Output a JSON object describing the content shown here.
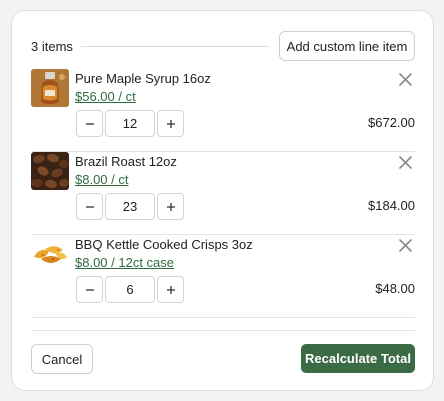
{
  "header": {
    "item_count": "3 items",
    "add_custom_label": "Add custom line item"
  },
  "items": [
    {
      "name": "Pure Maple Syrup 16oz",
      "price": "$56.00 / ct",
      "quantity": "12",
      "total": "$672.00",
      "thumbnail_icon": "maple-syrup-bottle"
    },
    {
      "name": "Brazil Roast 12oz",
      "price": "$8.00 / ct",
      "quantity": "23",
      "total": "$184.00",
      "thumbnail_icon": "coffee-beans"
    },
    {
      "name": "BBQ Kettle Cooked Crisps 3oz",
      "price": "$8.00 / 12ct case",
      "quantity": "6",
      "total": "$48.00",
      "thumbnail_icon": "potato-chips"
    }
  ],
  "footer": {
    "cancel_label": "Cancel",
    "recalculate_label": "Recalculate Total"
  },
  "colors": {
    "accent": "#3a6b45",
    "price_link": "#2f6b41",
    "border": "#dedede"
  }
}
